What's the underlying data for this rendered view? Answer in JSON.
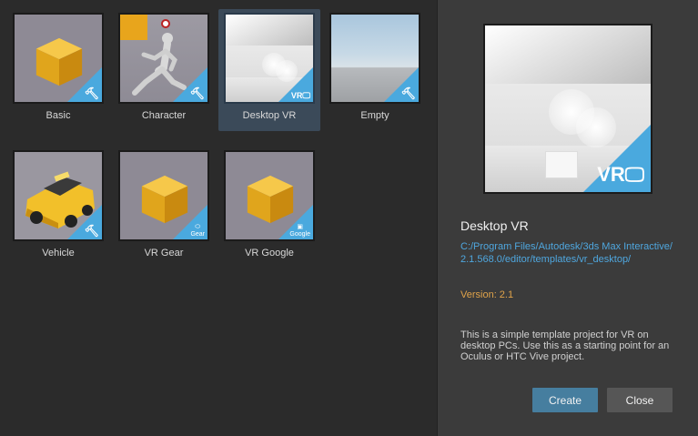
{
  "templates": [
    {
      "label": "Basic",
      "badge": "hammer-icon"
    },
    {
      "label": "Character",
      "badge": "hammer-icon"
    },
    {
      "label": "Desktop VR",
      "badge": "vr-monitor-icon",
      "selected": true
    },
    {
      "label": "Empty",
      "badge": "hammer-icon"
    },
    {
      "label": "Vehicle",
      "badge": "hammer-icon"
    },
    {
      "label": "VR Gear",
      "badge": "gear-vr-icon",
      "badge_text": "Gear"
    },
    {
      "label": "VR Google",
      "badge": "cardboard-icon",
      "badge_text": "Google"
    }
  ],
  "detail": {
    "title": "Desktop VR",
    "path": "C:/Program Files/Autodesk/3ds Max Interactive/2.1.568.0/editor/templates/vr_desktop/",
    "version": "Version: 2.1",
    "description": "This is a simple template project for VR on desktop PCs. Use this as a starting point for an Oculus or HTC Vive project.",
    "badge_text": "VR"
  },
  "buttons": {
    "create": "Create",
    "close": "Close"
  },
  "colors": {
    "accent": "#4aa9de",
    "create": "#467e9f",
    "version": "#e0a34a",
    "path": "#4fa7df"
  }
}
